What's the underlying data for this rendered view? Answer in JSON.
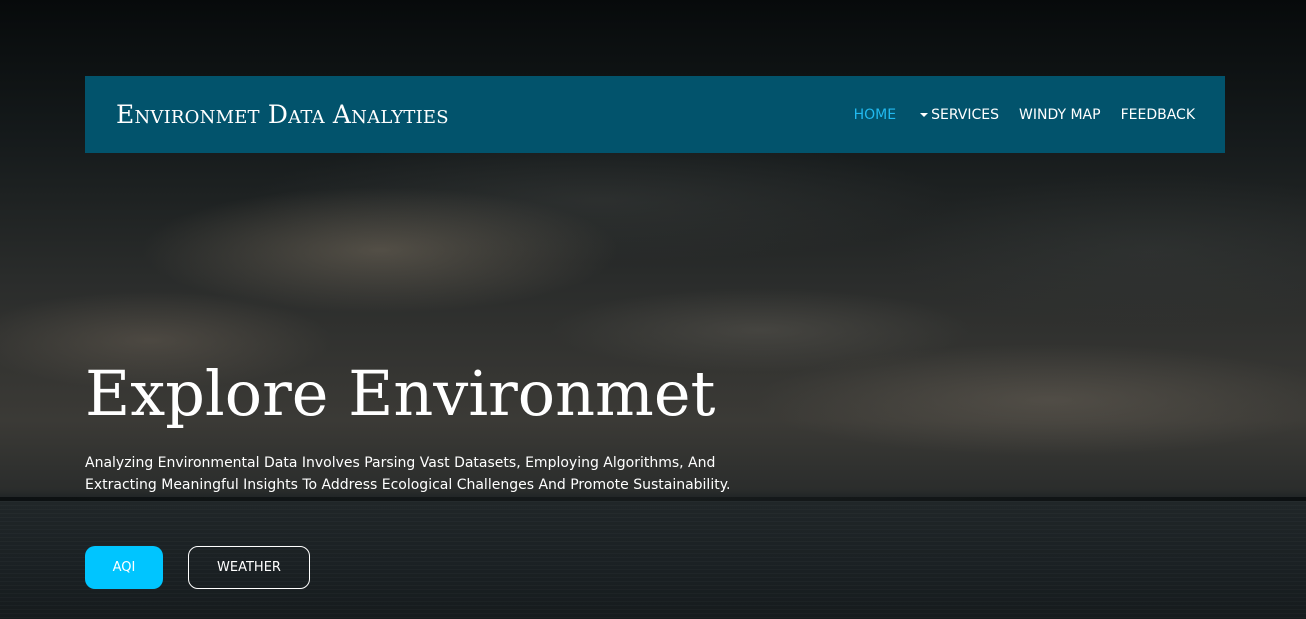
{
  "brand": {
    "title": "Environmet Data Analyties"
  },
  "nav": {
    "items": [
      {
        "label": "HOME",
        "active": true
      },
      {
        "label": "SERVICES",
        "has_dropdown": true,
        "icon": "caret-down-icon"
      },
      {
        "label": "WINDY MAP"
      },
      {
        "label": "FEEDBACK"
      }
    ]
  },
  "hero": {
    "title": "Explore Environmet",
    "description": "Analyzing Environmental Data Involves Parsing Vast Datasets, Employing Algorithms, And Extracting Meaningful Insights To Address Ecological Challenges And Promote Sustainability.",
    "buttons": {
      "primary_label": "AQI",
      "secondary_label": "WEATHER"
    }
  },
  "colors": {
    "navbar_bg": "#02536c",
    "nav_active": "#21b9ef",
    "primary_button": "#00c5ff",
    "text": "#ffffff"
  }
}
